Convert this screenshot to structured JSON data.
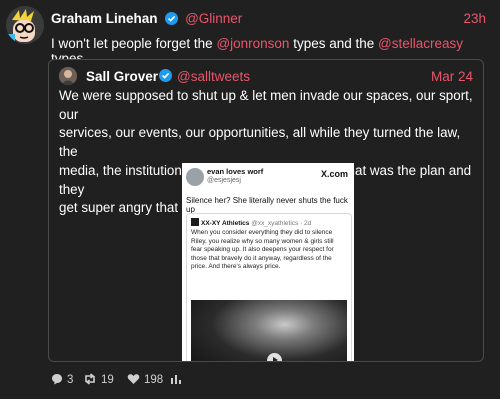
{
  "post": {
    "author": "Graham Linehan",
    "handle": "@Glinner",
    "time": "23h",
    "text_before": "I won't let people forget the ",
    "mention1": "@jonronson",
    "text_middle": " types and the ",
    "mention2": "@stellacreasy",
    "text_after": " types."
  },
  "quote": {
    "author": "Sall Grover",
    "handle": "@salltweets",
    "time": "Mar 24",
    "lines": [
      "We were supposed to shut up & let men invade our spaces, our sport, our",
      "services, our events, our opportunities, all while they turned the law, the",
      "media, the institutions & the culture against us. That was the plan and they",
      "get super angry that we didn't go along with it."
    ]
  },
  "embed": {
    "name": "evan loves worf",
    "handle": "@esjesjesj",
    "brand": "X.com",
    "line": "Silence her? She literally never shuts the fuck up",
    "quoted_name": "XX-XY Athletics",
    "quoted_handle": "@xx_xyathletics · 2d",
    "quoted_lines": [
      "When you consider everything they did to silence",
      "Riley, you realize why so many women & girls still",
      "fear speaking up. It also deepens your respect for",
      "those that bravely do it anyway, regardless of the",
      "price. And there's always price."
    ]
  },
  "actions": {
    "replies": "3",
    "reposts": "19",
    "likes": "198"
  },
  "colors": {
    "background": "#202020",
    "accent": "#e8566a",
    "verified": "#1d9bf0"
  },
  "icons": [
    "verified-badge-icon",
    "reply-icon",
    "repost-icon",
    "like-icon",
    "stats-icon",
    "play-icon"
  ]
}
